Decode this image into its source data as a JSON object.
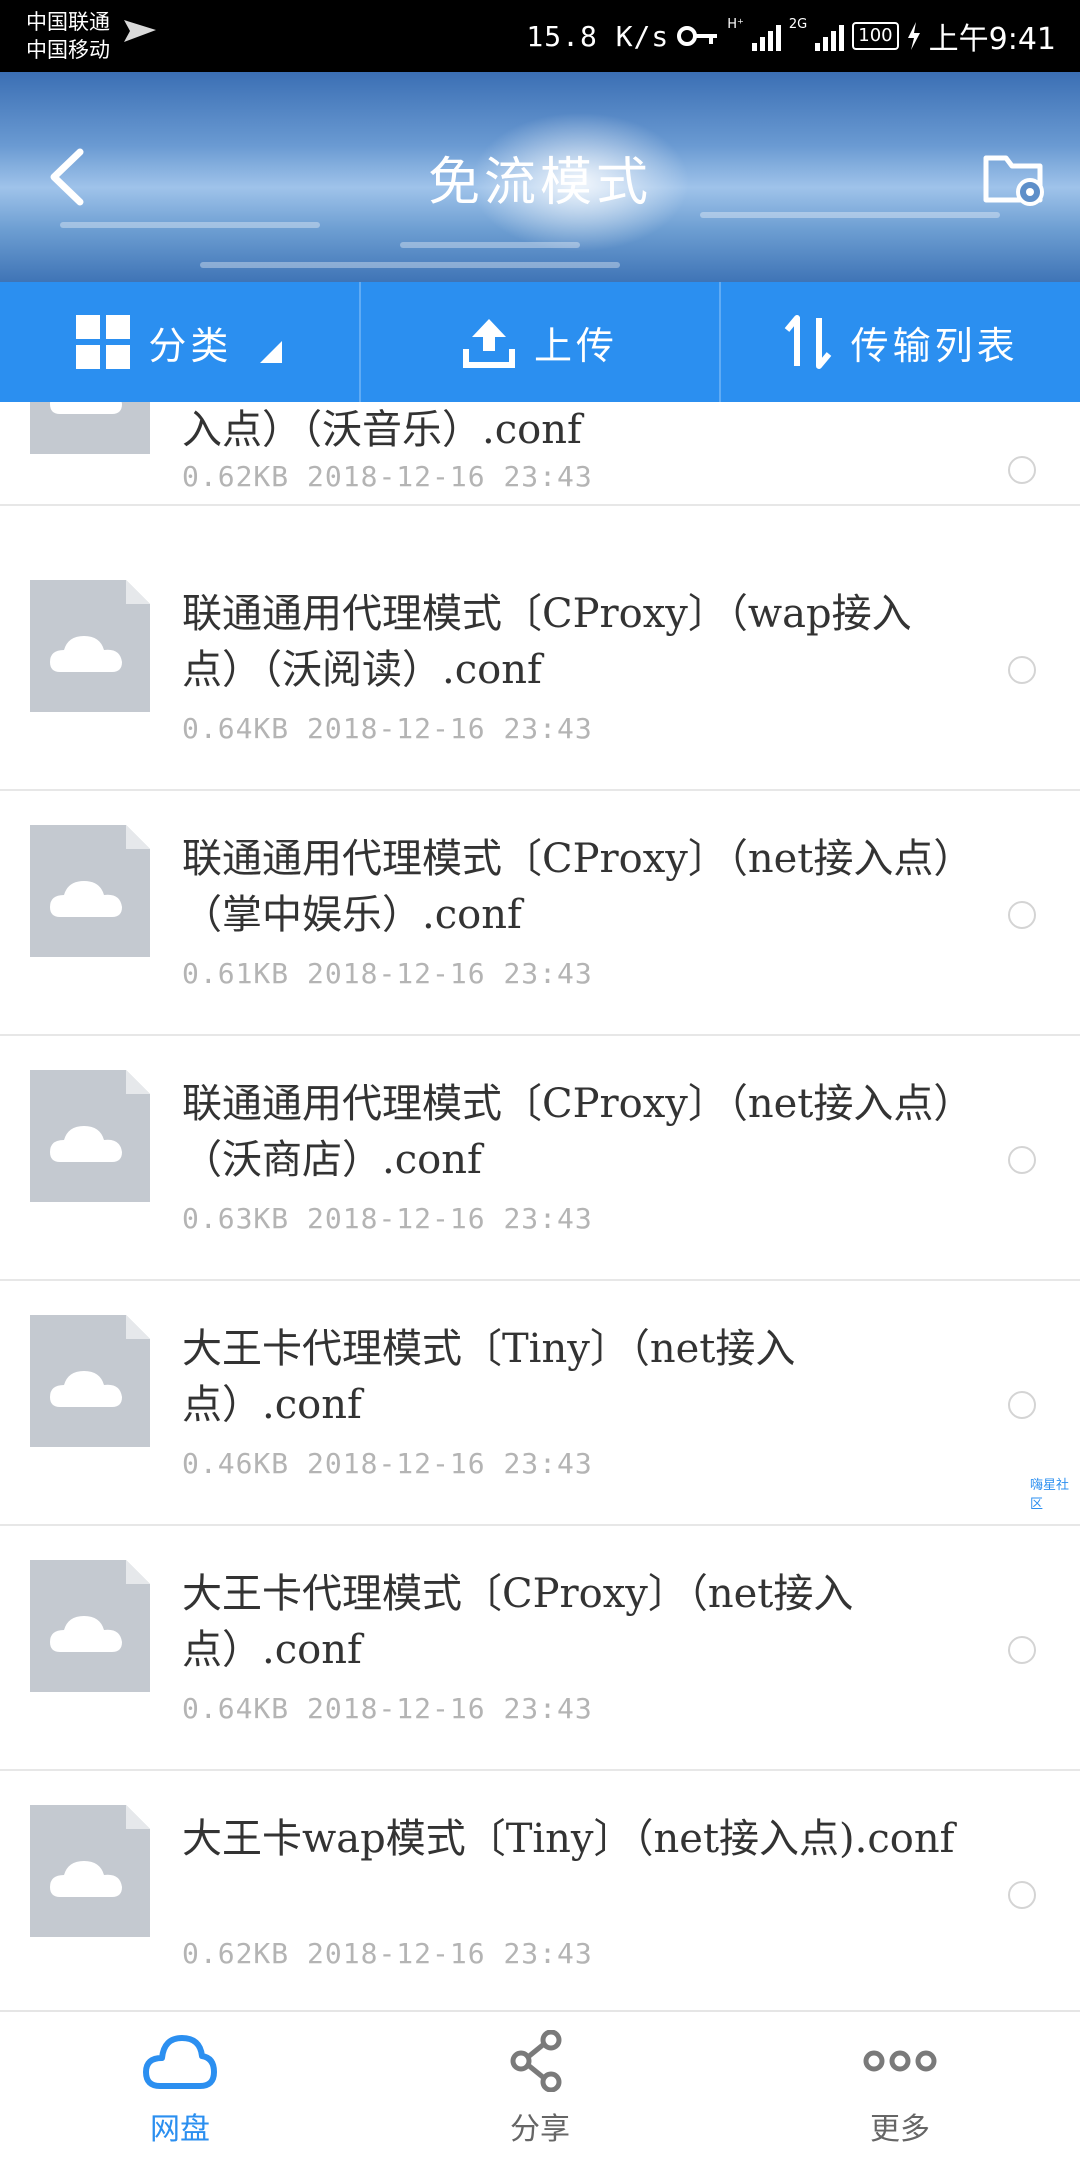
{
  "status_bar": {
    "carrier_1": "中国联通",
    "carrier_2": "中国移动",
    "speed": "15.8 K/s",
    "net_h": "H⁺",
    "net_2g": "2G",
    "battery": "100",
    "time": "上午9:41"
  },
  "header": {
    "title": "免流模式"
  },
  "toolbar": {
    "category_label": "分类",
    "upload_label": "上传",
    "transfer_label": "传输列表"
  },
  "files": [
    {
      "name": "入点）（沃音乐）.conf",
      "size": "0.62KB",
      "date": "2018-12-16",
      "time": "23:43"
    },
    {
      "name": "联通通用代理模式〔CProxy〕（wap接入点）（沃阅读）.conf",
      "size": "0.64KB",
      "date": "2018-12-16",
      "time": "23:43"
    },
    {
      "name": "联通通用代理模式〔CProxy〕（net接入点）（掌中娱乐）.conf",
      "size": "0.61KB",
      "date": "2018-12-16",
      "time": "23:43"
    },
    {
      "name": "联通通用代理模式〔CProxy〕（net接入点）（沃商店）.conf",
      "size": "0.63KB",
      "date": "2018-12-16",
      "time": "23:43"
    },
    {
      "name": "大王卡代理模式〔Tiny〕（net接入点）.conf",
      "size": "0.46KB",
      "date": "2018-12-16",
      "time": "23:43"
    },
    {
      "name": "大王卡代理模式〔CProxy〕（net接入点）.conf",
      "size": "0.64KB",
      "date": "2018-12-16",
      "time": "23:43"
    },
    {
      "name": "大王卡wap模式〔Tiny〕（net接入点).conf",
      "size": "0.62KB",
      "date": "2018-12-16",
      "time": "23:43"
    }
  ],
  "watermark": "嗨星社区",
  "bottom_nav": {
    "disk_label": "网盘",
    "share_label": "分享",
    "more_label": "更多"
  },
  "colors": {
    "accent": "#2b8ff0",
    "file_icon": "#c4c9d0"
  }
}
